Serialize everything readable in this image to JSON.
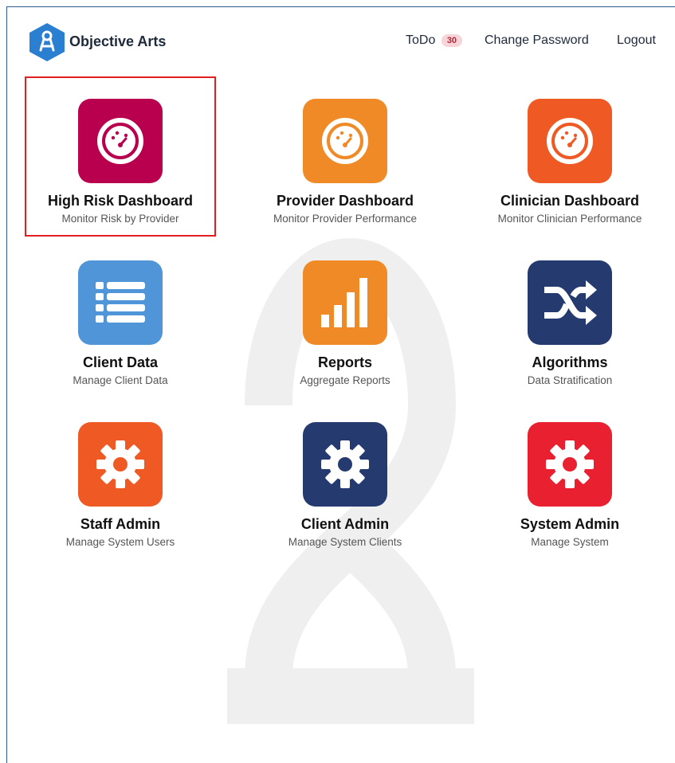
{
  "header": {
    "app_name": "Objective Arts",
    "todo_label": "ToDo",
    "todo_count": "30",
    "change_password": "Change Password",
    "logout": "Logout",
    "logo_color": "#2a7fd0"
  },
  "tiles": [
    {
      "title": "High Risk Dashboard",
      "subtitle": "Monitor Risk by Provider",
      "icon": "gauge-icon",
      "color": "#b8004f",
      "selected": true
    },
    {
      "title": "Provider Dashboard",
      "subtitle": "Monitor Provider Performance",
      "icon": "gauge-icon",
      "color": "#ef8a26"
    },
    {
      "title": "Clinician Dashboard",
      "subtitle": "Monitor Clinician Performance",
      "icon": "gauge-icon",
      "color": "#ef5a24"
    },
    {
      "title": "Client Data",
      "subtitle": "Manage Client Data",
      "icon": "list-icon",
      "color": "#4f95d8"
    },
    {
      "title": "Reports",
      "subtitle": "Aggregate Reports",
      "icon": "bar-chart-icon",
      "color": "#ef8a26"
    },
    {
      "title": "Algorithms",
      "subtitle": "Data Stratification",
      "icon": "shuffle-icon",
      "color": "#253a6e"
    },
    {
      "title": "Staff Admin",
      "subtitle": "Manage System Users",
      "icon": "gear-icon",
      "color": "#ef5a24"
    },
    {
      "title": "Client Admin",
      "subtitle": "Manage System Clients",
      "icon": "gear-icon",
      "color": "#253a6e"
    },
    {
      "title": "System Admin",
      "subtitle": "Manage System",
      "icon": "gear-icon",
      "color": "#e8202f"
    }
  ]
}
